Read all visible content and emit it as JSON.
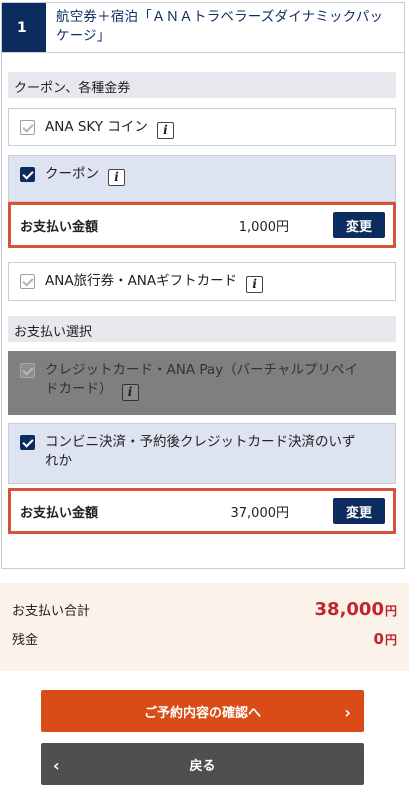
{
  "header": {
    "step_number": "1",
    "title": "航空券＋宿泊「ＡＮＡトラベラーズダイナミックパッケージ」"
  },
  "coupons_section": {
    "title": "クーポン、各種金券",
    "options": [
      {
        "label": "ANA SKY コイン",
        "checked": false
      },
      {
        "label": "クーポン",
        "checked": true
      },
      {
        "label": "ANA旅行券・ANAギフトカード",
        "checked": false
      }
    ],
    "coupon_payment": {
      "label": "お支払い金額",
      "amount": "1,000円",
      "change_label": "変更"
    }
  },
  "payment_section": {
    "title": "お支払い選択",
    "options": [
      {
        "label": "クレジットカード・ANA Pay（バーチャルプリペイドカード）",
        "checked": false,
        "disabled": true
      },
      {
        "label": "コンビニ決済・予約後クレジットカード決済のいずれか",
        "checked": true
      }
    ],
    "payment": {
      "label": "お支払い金額",
      "amount": "37,000円",
      "change_label": "変更"
    }
  },
  "summary": {
    "total_label": "お支払い合計",
    "total_value": "38,000",
    "total_unit": "円",
    "balance_label": "残金",
    "balance_value": "0",
    "balance_unit": "円"
  },
  "actions": {
    "confirm_label": "ご予約内容の確認へ",
    "back_label": "戻る"
  },
  "icons": {
    "info": "info-icon",
    "next": "chevron-right-icon",
    "back": "chevron-left-icon",
    "check": "checkmark-icon"
  },
  "colors": {
    "navy": "#0c2b5f",
    "orange_border": "#d5553a",
    "primary_button": "#d94c18",
    "back_button": "#4f4f4f",
    "price_red": "#c0262d",
    "summary_bg": "#fbf2ea",
    "selected_bg": "#dde3f1"
  }
}
